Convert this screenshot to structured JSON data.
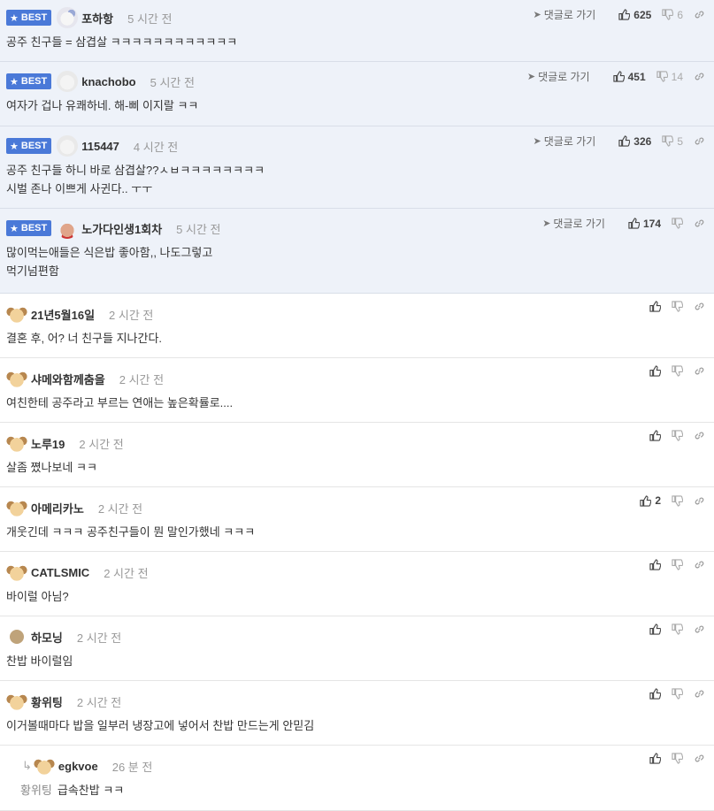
{
  "best_label": "BEST",
  "goto_label": "댓글로 가기",
  "best_comments": [
    {
      "name": "포하항",
      "time": "5 시간 전",
      "likes": "625",
      "dislikes": "6",
      "lines": [
        "공주 친구들 = 삼겹살 ㅋㅋㅋㅋㅋㅋㅋㅋㅋㅋㅋㅋ"
      ],
      "avatar": "bear-icon"
    },
    {
      "name": "knachobo",
      "time": "5 시간 전",
      "likes": "451",
      "dislikes": "14",
      "lines": [
        "여자가 겁나 유쾌하네. 해-삐 이지랄 ㅋㅋ"
      ],
      "avatar": "white-dog-icon"
    },
    {
      "name": "115447",
      "time": "4 시간 전",
      "likes": "326",
      "dislikes": "5",
      "lines": [
        "공주 친구들 하니 바로 삼겹살??ㅅㅂㅋㅋㅋㅋㅋㅋㅋㅋ",
        "시벌 존나 이쁘게 사귄다.. ㅜㅜ"
      ],
      "avatar": "white-dog-icon"
    },
    {
      "name": "노가다인생1회차",
      "time": "5 시간 전",
      "likes": "174",
      "dislikes": "",
      "lines": [
        "많이먹는애들은 식은밥 좋아함,, 나도그렇고",
        "먹기넘편함"
      ],
      "avatar": "pig-icon"
    }
  ],
  "comments": [
    {
      "name": "21년5월16일",
      "time": "2 시간 전",
      "likes": "",
      "text": "결혼 후, 어? 너 친구들 지나간다.",
      "avatar": "puppy-icon"
    },
    {
      "name": "샤메와함께춤을",
      "time": "2 시간 전",
      "likes": "",
      "text": "여친한테 공주라고 부르는 연애는 높은확률로....",
      "avatar": "puppy-icon"
    },
    {
      "name": "노루19",
      "time": "2 시간 전",
      "likes": "",
      "text": "살좀 쪘나보네 ㅋㅋ",
      "avatar": "puppy-icon"
    },
    {
      "name": "아메리카노",
      "time": "2 시간 전",
      "likes": "2",
      "text": "개웃긴데 ㅋㅋㅋ 공주친구들이 뭔 말인가했네 ㅋㅋㅋ",
      "avatar": "puppy-icon"
    },
    {
      "name": "CATLSMIC",
      "time": "2 시간 전",
      "likes": "",
      "text": "바이럴 아님?",
      "avatar": "puppy-icon"
    },
    {
      "name": "하모닝",
      "time": "2 시간 전",
      "likes": "",
      "text": "찬밥 바이럴임",
      "avatar": "circle-avatar-icon"
    },
    {
      "name": "황위팅",
      "time": "2 시간 전",
      "likes": "",
      "text": "이거볼때마다 밥을 일부러 냉장고에 넣어서 찬밥 만드는게 안믿김",
      "avatar": "puppy-icon"
    }
  ],
  "reply": {
    "name": "egkvoe",
    "time": "26 분 전",
    "reply_to": "황위팅",
    "text": "급속찬밥 ㅋㅋ",
    "avatar": "puppy-icon"
  }
}
